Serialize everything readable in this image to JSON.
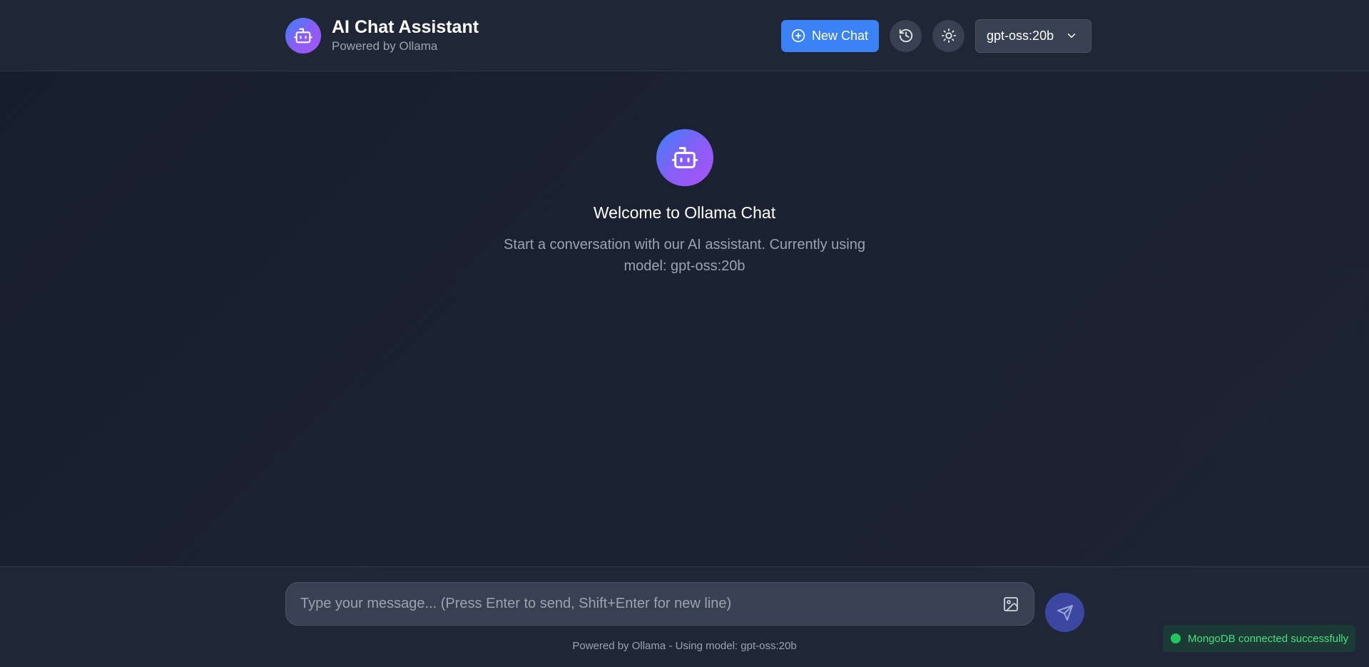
{
  "header": {
    "title": "AI Chat Assistant",
    "subtitle": "Powered by Ollama",
    "new_chat_label": "New Chat",
    "history_icon": "history-icon",
    "theme_icon": "sun-icon",
    "model_selected": "gpt-oss:20b"
  },
  "welcome": {
    "title": "Welcome to Ollama Chat",
    "description": "Start a conversation with our AI assistant. Currently using model: gpt-oss:20b"
  },
  "composer": {
    "placeholder": "Type your message... (Press Enter to send, Shift+Enter for new line)",
    "value": "",
    "footer_note": "Powered by Ollama - Using model: gpt-oss:20b"
  },
  "toast": {
    "message": "MongoDB connected successfully",
    "status_color": "#22c55e"
  },
  "colors": {
    "accent": "#3b82f6",
    "gradient_start": "#3b82f6",
    "gradient_end": "#a855f7",
    "background": "#182030",
    "panel": "#1f2737"
  }
}
